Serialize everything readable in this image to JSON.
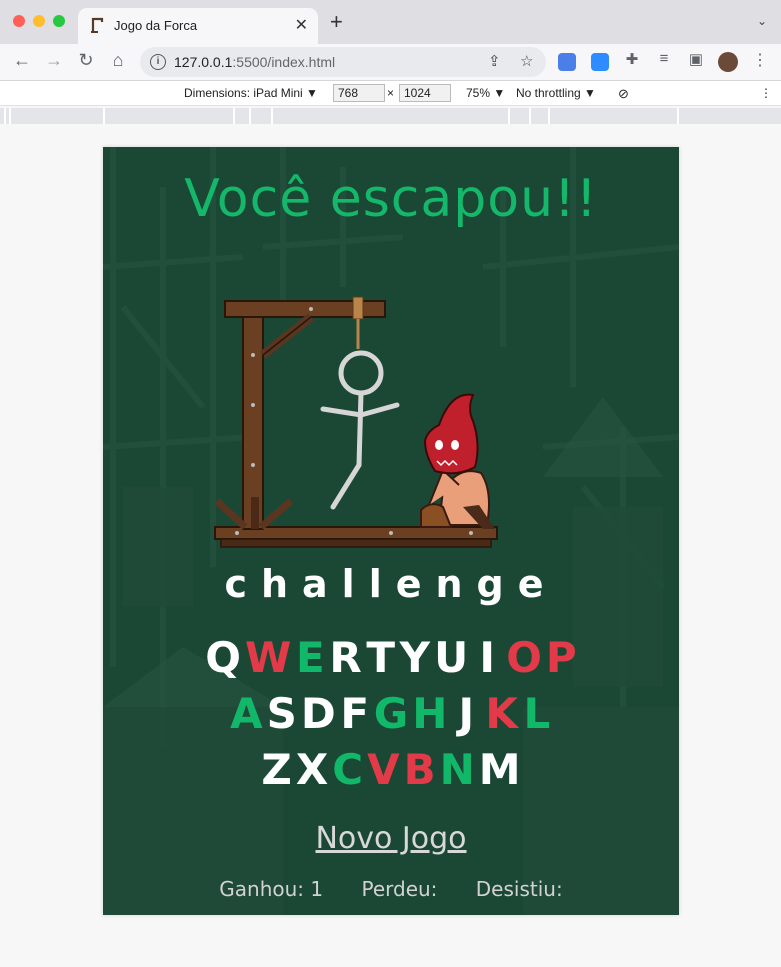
{
  "browser": {
    "tab_title": "Jogo da Forca",
    "tab_close": "✕",
    "new_tab": "+",
    "url_host": "127.0.0.1",
    "url_rest": ":5500/index.html",
    "devtools": {
      "dimensions_label": "Dimensions: iPad Mini ▼",
      "width": "768",
      "times": "×",
      "height": "1024",
      "zoom": "75% ▼",
      "throttling": "No throttling ▼"
    }
  },
  "game": {
    "result_title": "Você escapou!!",
    "word": "challenge",
    "keyboard": [
      [
        {
          "k": "Q",
          "s": "none"
        },
        {
          "k": "W",
          "s": "miss"
        },
        {
          "k": "E",
          "s": "hit"
        },
        {
          "k": "R",
          "s": "none"
        },
        {
          "k": "T",
          "s": "none"
        },
        {
          "k": "Y",
          "s": "none"
        },
        {
          "k": "U",
          "s": "none"
        },
        {
          "k": "I",
          "s": "none"
        },
        {
          "k": "O",
          "s": "miss"
        },
        {
          "k": "P",
          "s": "miss"
        }
      ],
      [
        {
          "k": "A",
          "s": "hit"
        },
        {
          "k": "S",
          "s": "none"
        },
        {
          "k": "D",
          "s": "none"
        },
        {
          "k": "F",
          "s": "none"
        },
        {
          "k": "G",
          "s": "hit"
        },
        {
          "k": "H",
          "s": "hit"
        },
        {
          "k": "J",
          "s": "none"
        },
        {
          "k": "K",
          "s": "miss"
        },
        {
          "k": "L",
          "s": "hit"
        }
      ],
      [
        {
          "k": "Z",
          "s": "none"
        },
        {
          "k": "X",
          "s": "none"
        },
        {
          "k": "C",
          "s": "hit"
        },
        {
          "k": "V",
          "s": "miss"
        },
        {
          "k": "B",
          "s": "miss"
        },
        {
          "k": "N",
          "s": "hit"
        },
        {
          "k": "M",
          "s": "none"
        }
      ]
    ],
    "new_game_label": "Novo Jogo",
    "stats": {
      "won": "Ganhou: 1",
      "lost": "Perdeu:",
      "gave_up": "Desistiu:"
    },
    "colors": {
      "hit": "#12b86a",
      "miss": "#e23a48",
      "background": "#1c4a36"
    }
  }
}
